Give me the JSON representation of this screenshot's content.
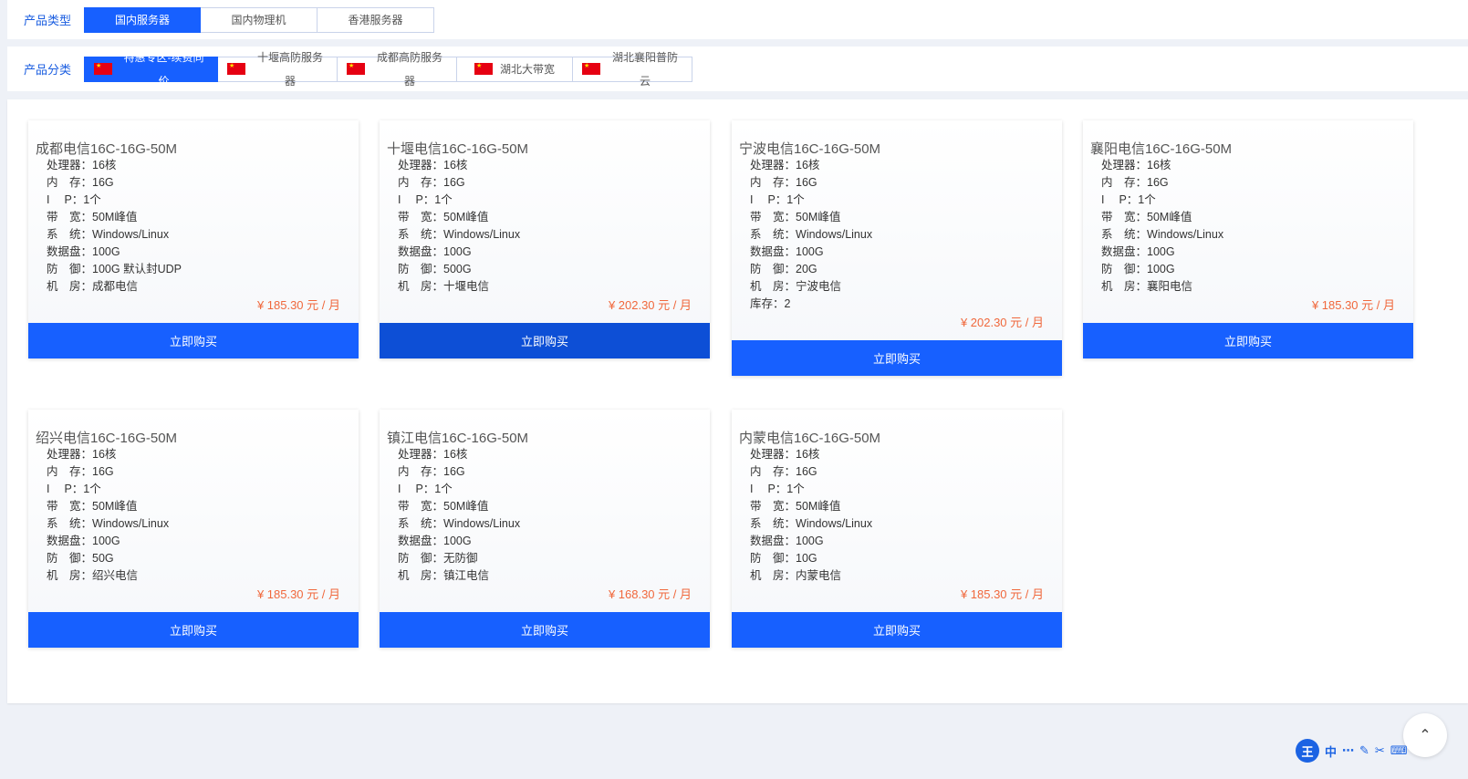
{
  "product_type": {
    "label": "产品类型",
    "options": [
      "国内服务器",
      "国内物理机",
      "香港服务器"
    ]
  },
  "product_category": {
    "label": "产品分类",
    "options": [
      "特惠专区-续费同价",
      "十堰高防服务器",
      "成都高防服务器",
      "湖北大带宽",
      "湖北襄阳普防云"
    ]
  },
  "buy_label": "立即购买",
  "spec_keys": {
    "cpu": "处理器：",
    "mem": "内　存：",
    "ip": "I　  P：",
    "bw": "带　宽：",
    "os": "系　统：",
    "disk": "数据盘：",
    "def": "防　御：",
    "room": "机　房：",
    "stock": "库存："
  },
  "cards": [
    {
      "title": "成都电信16C-16G-50M",
      "cpu": "16核",
      "mem": "16G",
      "ip": "1个",
      "bw": "50M峰值",
      "os": "Windows/Linux",
      "disk": "100G",
      "def": "100G 默认封UDP",
      "room": "成都电信",
      "price": "¥ 185.30 元 / 月"
    },
    {
      "title": "十堰电信16C-16G-50M",
      "cpu": "16核",
      "mem": "16G",
      "ip": "1个",
      "bw": "50M峰值",
      "os": "Windows/Linux",
      "disk": "100G",
      "def": "500G",
      "room": "十堰电信",
      "price": "¥ 202.30 元 / 月"
    },
    {
      "title": "宁波电信16C-16G-50M",
      "cpu": "16核",
      "mem": "16G",
      "ip": "1个",
      "bw": "50M峰值",
      "os": "Windows/Linux",
      "disk": "100G",
      "def": "20G",
      "room": "宁波电信",
      "stock": "2",
      "price": "¥ 202.30 元 / 月"
    },
    {
      "title": "襄阳电信16C-16G-50M",
      "cpu": "16核",
      "mem": "16G",
      "ip": "1个",
      "bw": "50M峰值",
      "os": "Windows/Linux",
      "disk": "100G",
      "def": "100G",
      "room": "襄阳电信",
      "price": "¥ 185.30 元 / 月"
    },
    {
      "title": "绍兴电信16C-16G-50M",
      "cpu": "16核",
      "mem": "16G",
      "ip": "1个",
      "bw": "50M峰值",
      "os": "Windows/Linux",
      "disk": "100G",
      "def": "50G",
      "room": "绍兴电信",
      "price": "¥ 185.30 元 / 月"
    },
    {
      "title": "镇江电信16C-16G-50M",
      "cpu": "16核",
      "mem": "16G",
      "ip": "1个",
      "bw": "50M峰值",
      "os": "Windows/Linux",
      "disk": "100G",
      "def": "无防御",
      "room": "镇江电信",
      "price": "¥ 168.30 元 / 月"
    },
    {
      "title": "内蒙电信16C-16G-50M",
      "cpu": "16核",
      "mem": "16G",
      "ip": "1个",
      "bw": "50M峰值",
      "os": "Windows/Linux",
      "disk": "100G",
      "def": "10G",
      "room": "内蒙电信",
      "price": "¥ 185.30 元 / 月"
    }
  ],
  "ime_toolbar": {
    "badge": "王",
    "lang": "中",
    "icons": [
      "dots-icon",
      "pen-icon",
      "scissors-icon",
      "keyboard-icon"
    ]
  },
  "colors": {
    "accent": "#1760ff",
    "price": "#f0683c",
    "label": "#1a5de0"
  }
}
